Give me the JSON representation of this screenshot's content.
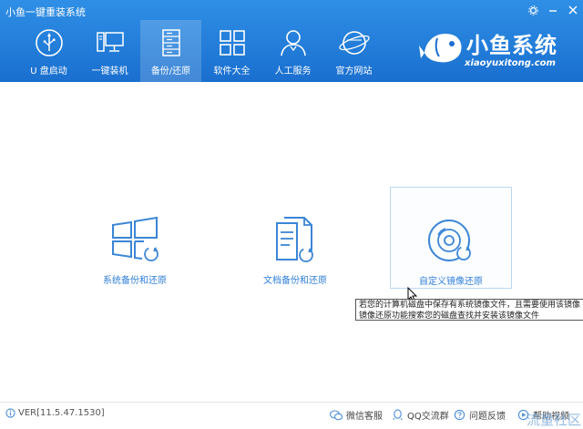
{
  "window": {
    "title": "小鱼一键重装系统",
    "controls": [
      "settings-icon",
      "minimize-icon",
      "close-icon"
    ]
  },
  "nav": {
    "items": [
      {
        "label": "U 盘启动",
        "icon": "usb-icon"
      },
      {
        "label": "一键装机",
        "icon": "monitor-icon"
      },
      {
        "label": "备份/还原",
        "icon": "backup-icon",
        "active": true
      },
      {
        "label": "软件大全",
        "icon": "apps-grid-icon"
      },
      {
        "label": "人工服务",
        "icon": "person-icon"
      },
      {
        "label": "官方网站",
        "icon": "globe-icon"
      }
    ]
  },
  "brand": {
    "name": "小鱼系统",
    "url": "xiaoyuxitong.com"
  },
  "options": [
    {
      "label": "系统备份和还原",
      "icon": "windows-restore-icon"
    },
    {
      "label": "文档备份和还原",
      "icon": "document-restore-icon"
    },
    {
      "label": "自定义镜像还原",
      "icon": "disc-restore-icon",
      "selected": true
    }
  ],
  "tooltip": {
    "line1": "若您的计算机磁盘中保存有系统镜像文件，且需要使用该镜像",
    "line2": "镜像还原功能搜索您的磁盘查找并安装该镜像文件"
  },
  "footer": {
    "version": "VER[11.5.47.1530]",
    "links": [
      {
        "label": "微信客服",
        "icon": "wechat-icon"
      },
      {
        "label": "QQ交流群",
        "icon": "qq-icon"
      },
      {
        "label": "问题反馈",
        "icon": "feedback-icon"
      },
      {
        "label": "帮助视频",
        "icon": "help-video-icon"
      }
    ]
  },
  "watermark": "流量社区",
  "colors": {
    "header": "#1f7fdc",
    "accent": "#2f7fd6",
    "active_tab": "#4a9ae8"
  }
}
